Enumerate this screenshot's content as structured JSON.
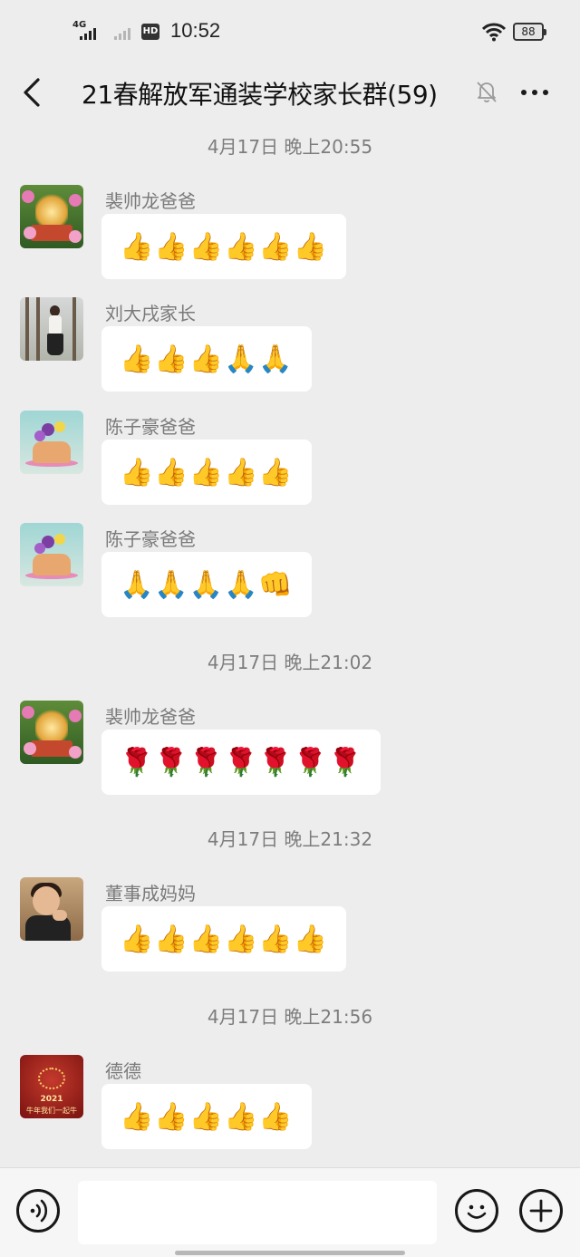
{
  "status_bar": {
    "network": "4G",
    "hd": "HD",
    "time": "10:52",
    "battery": "88"
  },
  "header": {
    "title": "21春解放军通装学校家长群(59)"
  },
  "timestamps": [
    "4月17日 晚上20:55",
    "4月17日 晚上21:02",
    "4月17日 晚上21:32",
    "4月17日 晚上21:56"
  ],
  "messages": [
    {
      "sender": "裴帅龙爸爸",
      "content": "👍👍👍👍👍👍",
      "avatar": "shrine-avatar"
    },
    {
      "sender": "刘大戌家长",
      "content": "👍👍👍🙏🙏",
      "avatar": "woman-photo-avatar"
    },
    {
      "sender": "陈子豪爸爸",
      "content": "👍👍👍👍👍",
      "avatar": "cake-flowers-avatar"
    },
    {
      "sender": "陈子豪爸爸",
      "content": "🙏🙏🙏🙏👊",
      "avatar": "cake-flowers-avatar"
    },
    {
      "sender": "裴帅龙爸爸",
      "content": "🌹🌹🌹🌹🌹🌹🌹",
      "avatar": "shrine-avatar"
    },
    {
      "sender": "董事成妈妈",
      "content": "👍👍👍👍👍👍",
      "avatar": "boy-photo-avatar"
    },
    {
      "sender": "德德",
      "content": "👍👍👍👍👍",
      "avatar": "new-year-avatar"
    }
  ],
  "avatar_text": {
    "year": "2021",
    "slogan": "牛年我们一起牛"
  },
  "input_bar": {
    "placeholder": ""
  },
  "colors": {
    "background": "#ededed",
    "bubble": "#ffffff",
    "meta_text": "#7d7d7d"
  }
}
